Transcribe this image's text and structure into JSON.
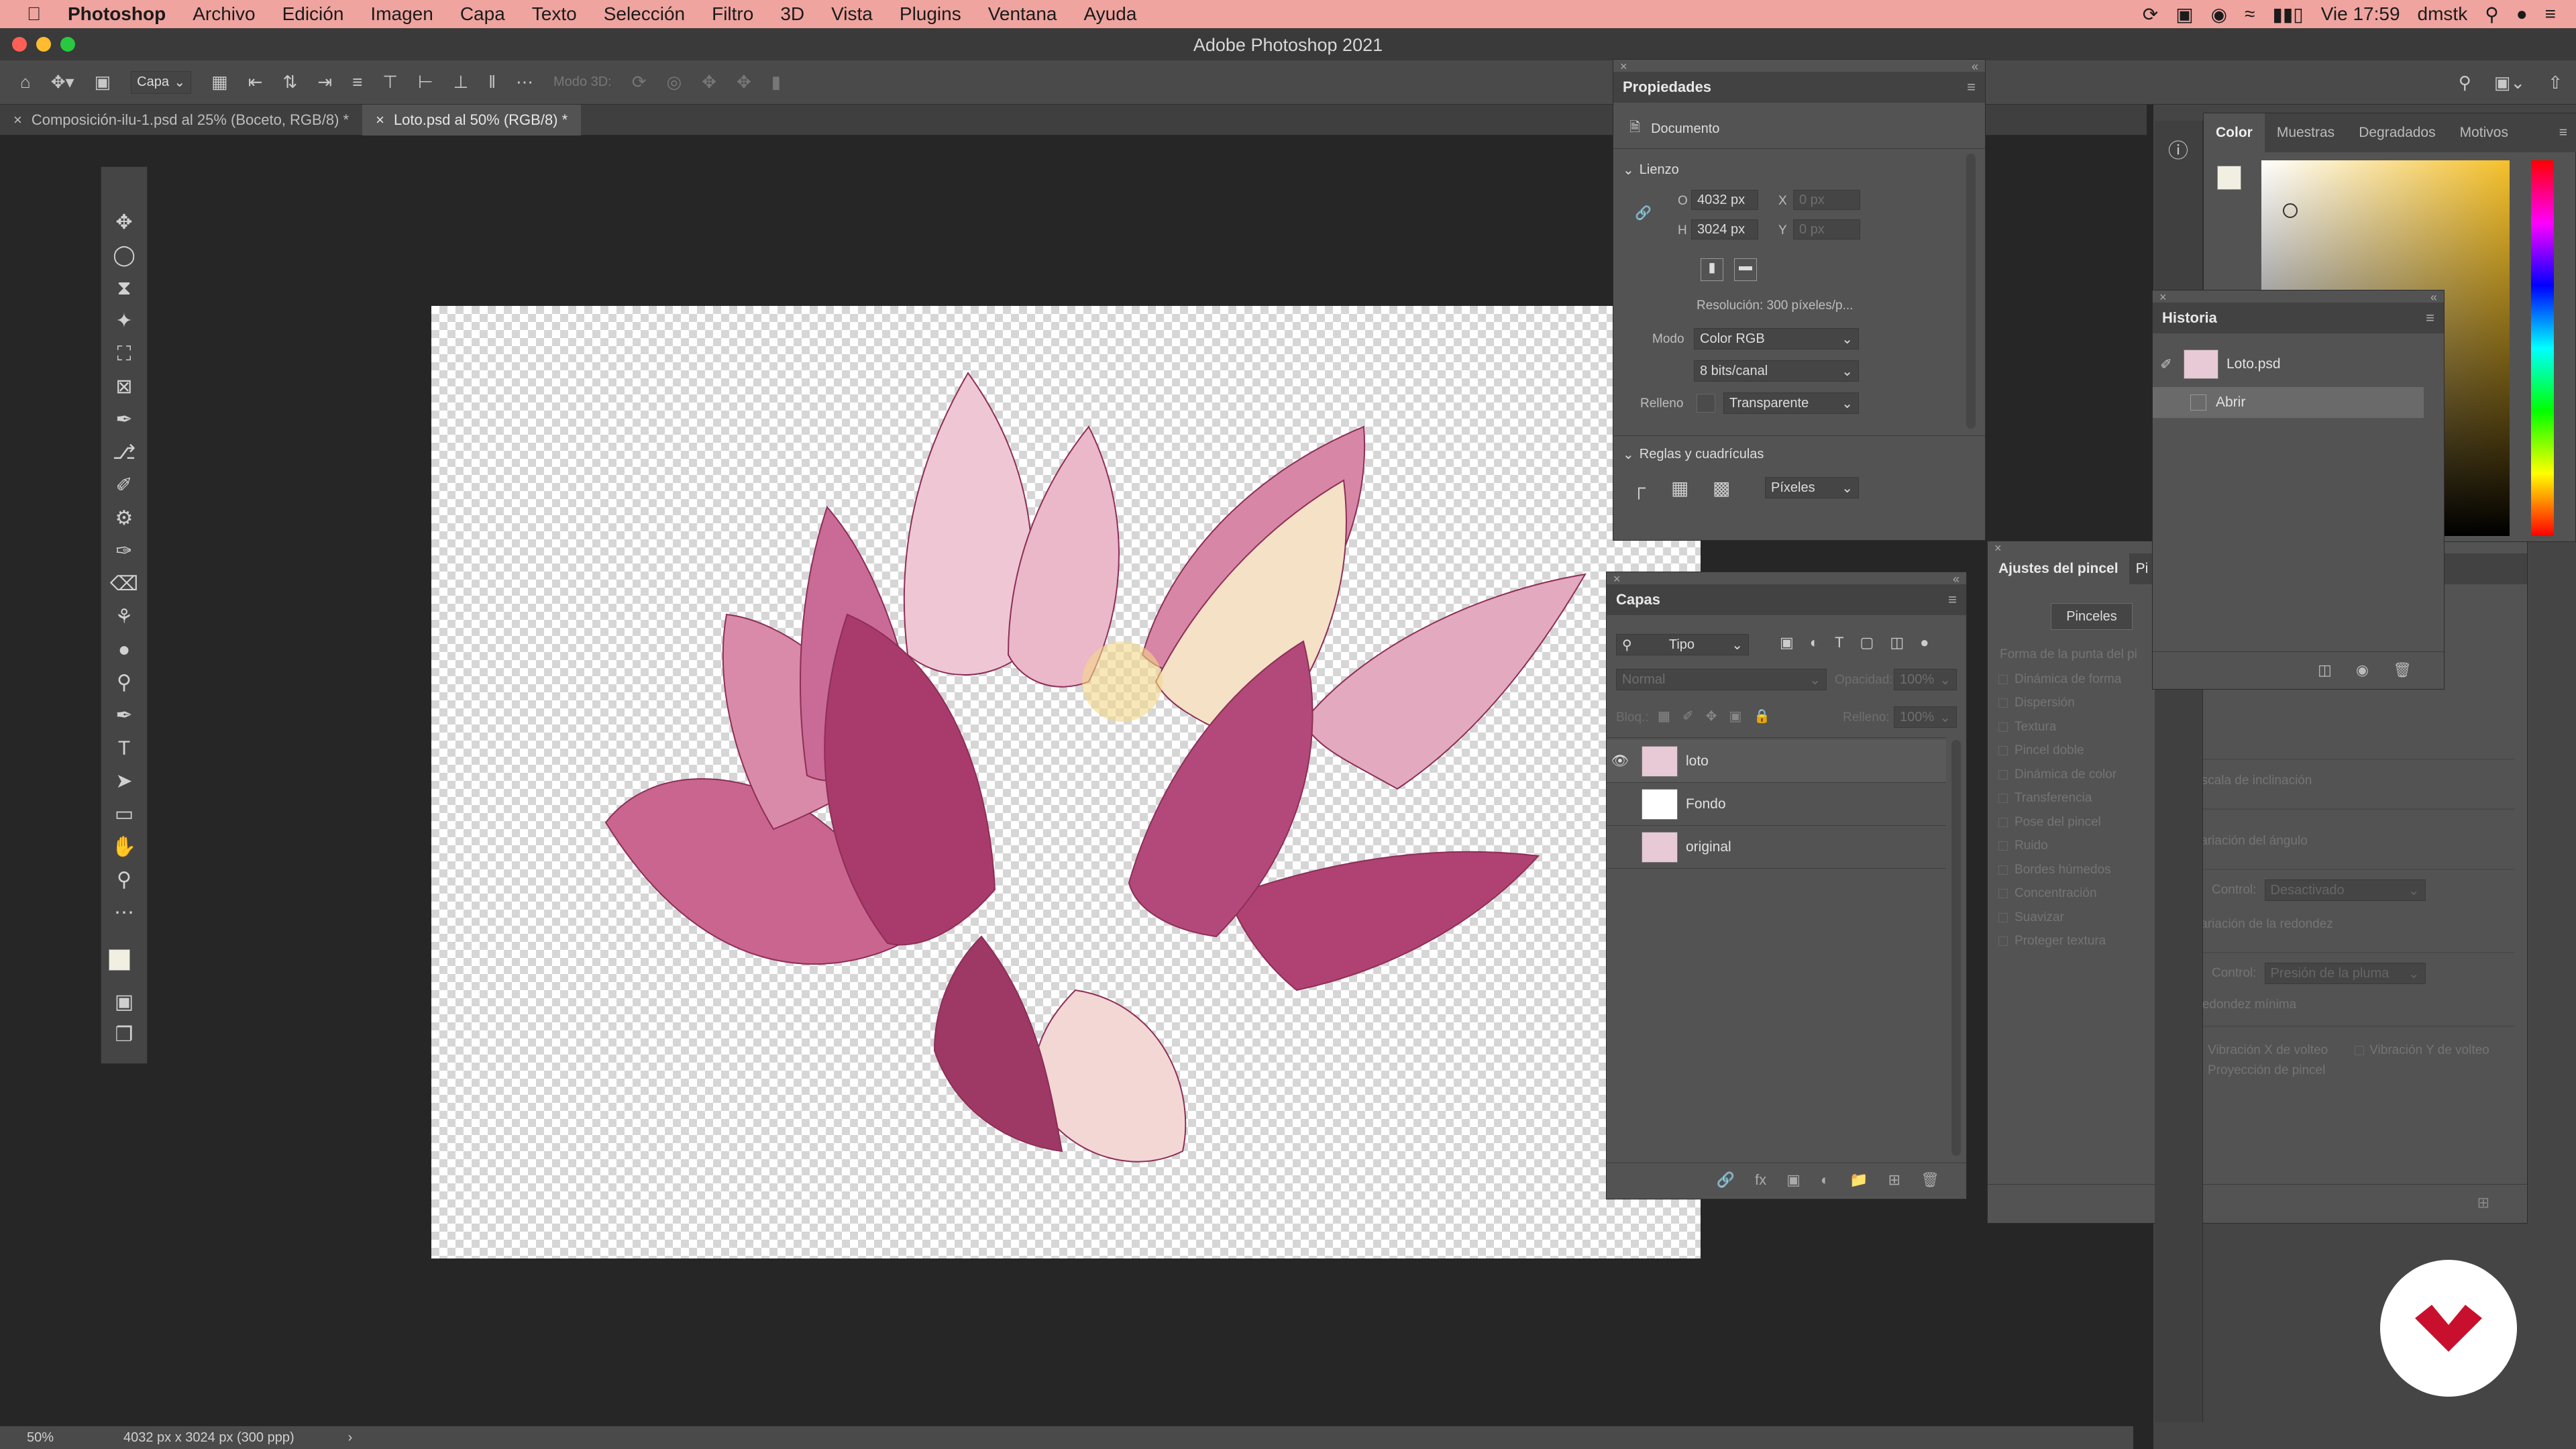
{
  "menubar": {
    "app": "Photoshop",
    "items": [
      "Archivo",
      "Edición",
      "Imagen",
      "Capa",
      "Texto",
      "Selección",
      "Filtro",
      "3D",
      "Vista",
      "Plugins",
      "Ventana",
      "Ayuda"
    ],
    "clock": "Vie 17:59",
    "user": "dmstk"
  },
  "window": {
    "title": "Adobe Photoshop 2021"
  },
  "options": {
    "layer_select": "Capa",
    "mode3d": "Modo 3D:"
  },
  "tabs": [
    {
      "label": "Composición-ilu-1.psd al 25% (Boceto, RGB/8) *"
    },
    {
      "label": "Loto.psd al 50% (RGB/8) *"
    }
  ],
  "properties": {
    "title": "Propiedades",
    "kind": "Documento",
    "section_canvas": "Lienzo",
    "w_label": "O",
    "w_value": "4032 px",
    "h_label": "H",
    "h_value": "3024 px",
    "x_label": "X",
    "x_value": "0 px",
    "y_label": "Y",
    "y_value": "0 px",
    "resolution": "Resolución: 300 píxeles/p...",
    "mode_label": "Modo",
    "mode_value": "Color RGB",
    "depth_value": "8 bits/canal",
    "fill_label": "Relleno",
    "fill_value": "Transparente",
    "section_rulers": "Reglas y cuadrículas",
    "units_value": "Píxeles"
  },
  "layers": {
    "title": "Capas",
    "filter": "Tipo",
    "blend": "Normal",
    "opacity_label": "Opacidad:",
    "opacity_value": "100%",
    "lock_label": "Bloq.:",
    "fill_label": "Relleno:",
    "fill_value": "100%",
    "items": [
      {
        "name": "loto",
        "visible": true
      },
      {
        "name": "Fondo",
        "visible": false
      },
      {
        "name": "original",
        "visible": false
      }
    ]
  },
  "brush": {
    "tab1": "Ajustes del pincel",
    "tab2": "Pi",
    "brushes_button": "Pinceles",
    "tip_shape": "Forma de la punta del pi",
    "options": [
      "Dinámica de forma",
      "Dispersión",
      "Textura",
      "Pincel doble",
      "Dinámica de color",
      "Transferencia",
      "Pose del pincel",
      "Ruido",
      "Bordes húmedos",
      "Concentración",
      "Suavizar",
      "Proteger textura"
    ],
    "tilt_scale": "Escala de inclinación",
    "angle_jitter": "Variación del ángulo",
    "control_label": "Control:",
    "control1": "Desactivado",
    "round_jitter": "Variación de la redondez",
    "control2": "Presión de la pluma",
    "min_round": "Redondez mínima",
    "flip_x": "Vibración X de volteo",
    "flip_y": "Vibración Y de volteo",
    "projection": "Proyección de pincel"
  },
  "color": {
    "tabs": [
      "Color",
      "Muestras",
      "Degradados",
      "Motivos"
    ]
  },
  "history": {
    "title": "Historia",
    "snapshot": "Loto.psd",
    "items": [
      "Abrir"
    ]
  },
  "status": {
    "zoom": "50%",
    "doc_info": "4032 px x 3024 px (300 ppp)"
  }
}
